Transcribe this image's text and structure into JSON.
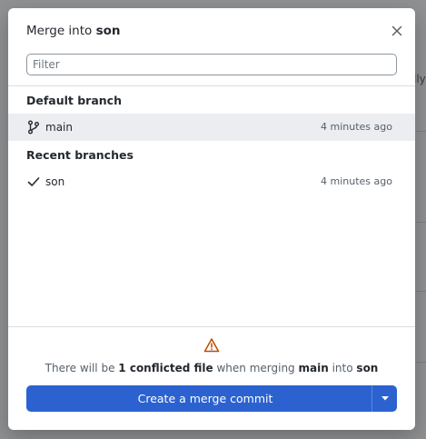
{
  "background": {
    "partial_text": "lly"
  },
  "dialog": {
    "title_prefix": "Merge into",
    "title_branch": "son",
    "close_icon": "close-icon",
    "filter": {
      "placeholder": "Filter",
      "value": ""
    },
    "sections": {
      "default_header": "Default branch",
      "recent_header": "Recent branches"
    },
    "branches": [
      {
        "name": "main",
        "time": "4 minutes ago",
        "icon": "git-branch-icon",
        "selected": true
      },
      {
        "name": "son",
        "time": "4 minutes ago",
        "icon": "check-icon",
        "selected": false
      }
    ],
    "merge_status": {
      "icon": "warning-icon",
      "text_1": "There will be",
      "conflict_count_text": "1 conflicted file",
      "text_2": "when merging",
      "source_branch": "main",
      "text_3": "into",
      "target_branch": "son"
    },
    "action": {
      "button_label": "Create a merge commit",
      "dropdown_icon": "caret-down-icon"
    }
  },
  "colors": {
    "accent": "#2b62cf",
    "warning": "#bc4c00",
    "selected_row": "#ebedf0",
    "backdrop": "#8f9193"
  }
}
